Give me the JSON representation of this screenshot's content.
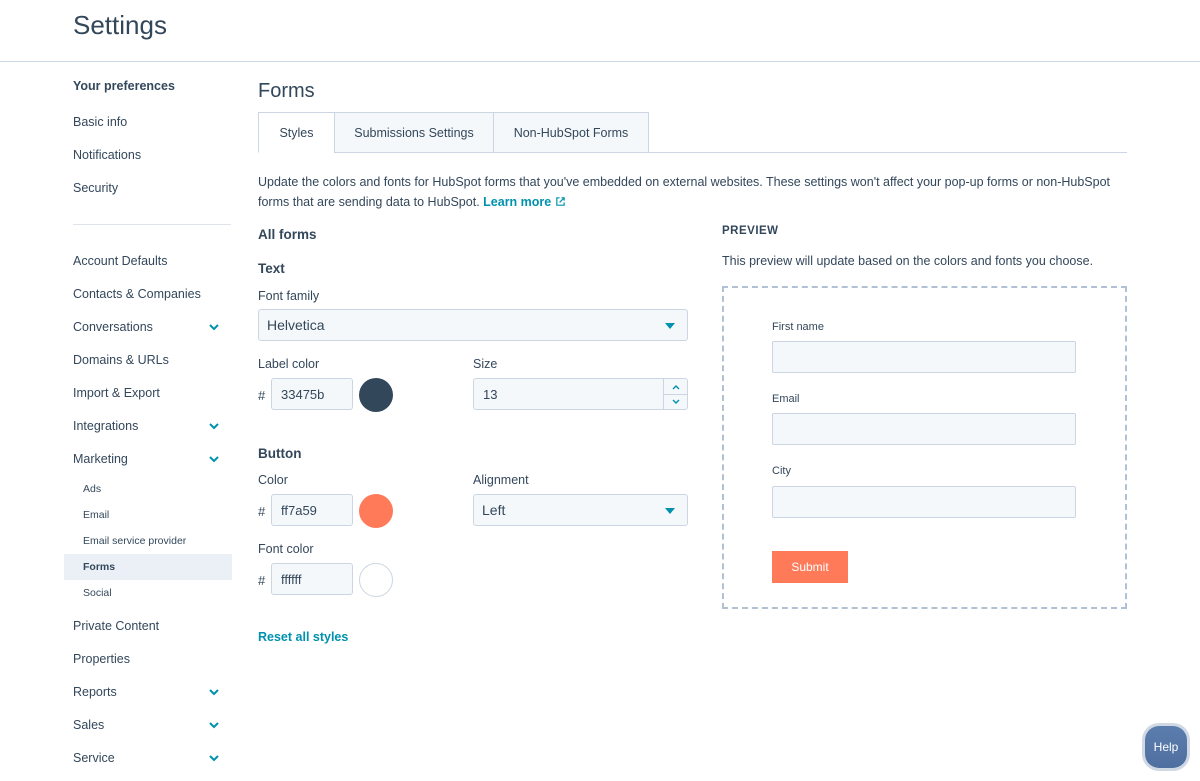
{
  "header": {
    "title": "Settings"
  },
  "sidebar": {
    "section_title": "Your preferences",
    "preferences": [
      "Basic info",
      "Notifications",
      "Security"
    ],
    "items": [
      {
        "label": "Account Defaults",
        "expandable": false
      },
      {
        "label": "Contacts & Companies",
        "expandable": false
      },
      {
        "label": "Conversations",
        "expandable": true
      },
      {
        "label": "Domains & URLs",
        "expandable": false
      },
      {
        "label": "Import & Export",
        "expandable": false
      },
      {
        "label": "Integrations",
        "expandable": true
      },
      {
        "label": "Marketing",
        "expandable": true
      }
    ],
    "marketing_sub": [
      "Ads",
      "Email",
      "Email service provider",
      "Forms",
      "Social"
    ],
    "active_item": "Forms",
    "items_after": [
      {
        "label": "Private Content",
        "expandable": false
      },
      {
        "label": "Properties",
        "expandable": false
      },
      {
        "label": "Reports",
        "expandable": true
      },
      {
        "label": "Sales",
        "expandable": true
      },
      {
        "label": "Service",
        "expandable": true
      }
    ],
    "chevron_icon": "chevron-down-icon"
  },
  "main": {
    "title": "Forms",
    "tabs": [
      {
        "label": "Styles",
        "active": true
      },
      {
        "label": "Submissions Settings",
        "active": false
      },
      {
        "label": "Non-HubSpot Forms",
        "active": false
      }
    ],
    "description": "Update the colors and fonts for HubSpot forms that you've embedded on external websites. These settings won't affect your pop-up forms or non-HubSpot forms that are sending data to HubSpot.",
    "learn_more": "Learn more",
    "external_link_icon": "external-link-icon",
    "all_forms_heading": "All forms",
    "text_heading": "Text",
    "font_family_label": "Font family",
    "font_family_value": "Helvetica",
    "label_color_label": "Label color",
    "hash": "#",
    "label_color_value": "33475b",
    "label_color_hex": "#33475b",
    "size_label": "Size",
    "size_value": "13",
    "button_heading": "Button",
    "color_label": "Color",
    "button_color_value": "ff7a59",
    "button_color_hex": "#ff7a59",
    "alignment_label": "Alignment",
    "alignment_value": "Left",
    "font_color_label": "Font color",
    "font_color_value": "ffffff",
    "font_color_hex": "#ffffff",
    "reset_label": "Reset all styles"
  },
  "preview": {
    "heading": "PREVIEW",
    "description": "This preview will update based on the colors and fonts you choose.",
    "fields": [
      "First name",
      "Email",
      "City"
    ],
    "submit_label": "Submit"
  },
  "help_label": "Help",
  "colors": {
    "accent": "#0091ae",
    "text": "#33475b",
    "border": "#cbd6e2",
    "submit": "#ff7a59"
  }
}
